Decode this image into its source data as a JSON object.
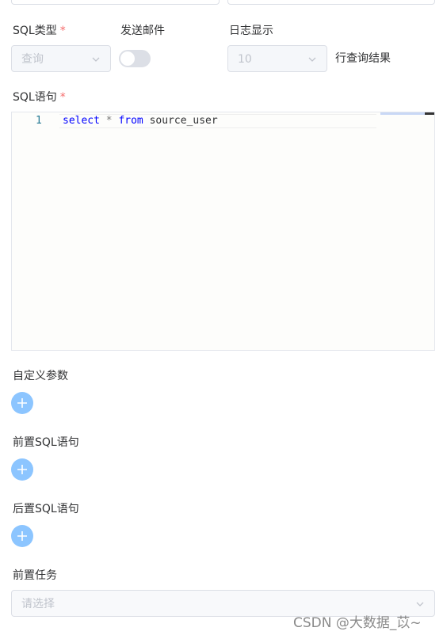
{
  "sql_type": {
    "label": "SQL类型",
    "required_mark": "*",
    "value": "查询"
  },
  "send_email": {
    "label": "发送邮件",
    "enabled": false
  },
  "log_display": {
    "label": "日志显示",
    "value": "10",
    "suffix": "行查询结果"
  },
  "sql_statement": {
    "label": "SQL语句",
    "required_mark": "*",
    "line_number": "1",
    "code": {
      "keyword1": "select",
      "op": " * ",
      "keyword2": "from",
      "rest": " source_user"
    }
  },
  "custom_params": {
    "label": "自定义参数"
  },
  "pre_sql": {
    "label": "前置SQL语句"
  },
  "post_sql": {
    "label": "后置SQL语句"
  },
  "pre_task": {
    "label": "前置任务",
    "placeholder": "请选择"
  },
  "watermark": "CSDN @大数据_苡~",
  "icons": {
    "chevron": "chevron-down-icon",
    "plus": "plus-icon"
  },
  "colors": {
    "required": "#f56c6c",
    "plus_button": "#8cc5ff",
    "keyword": "#0000ff"
  }
}
